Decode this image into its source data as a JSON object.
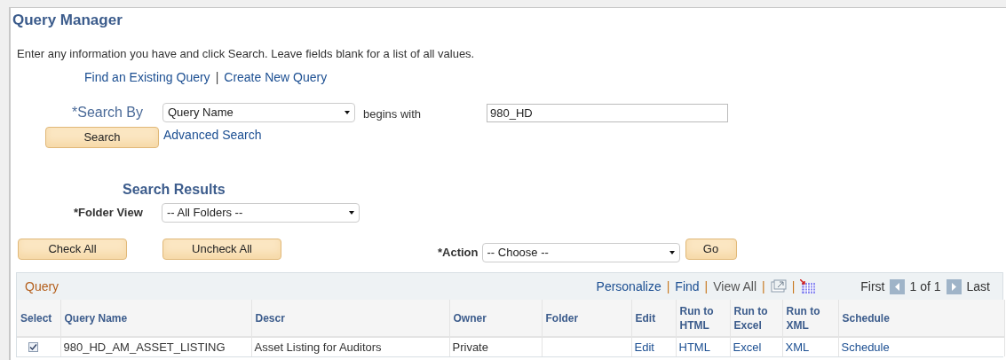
{
  "title": "Query Manager",
  "instructions": "Enter any information you have and click Search. Leave fields blank for a list of all values.",
  "nav_links": [
    {
      "kind": "link",
      "label": "Find an Existing Query"
    },
    {
      "kind": "separator",
      "label": "|"
    },
    {
      "kind": "link",
      "label": "Create New Query"
    }
  ],
  "search_by": {
    "label": "*Search By",
    "value": "Query Name",
    "operator": "begins with",
    "text": "980_HD"
  },
  "search_button": "Search",
  "advanced_search": "Advanced Search",
  "results_heading": "Search Results",
  "folder_view": {
    "label": "*Folder View",
    "value": "-- All Folders --"
  },
  "check_all": "Check All",
  "uncheck_all": "Uncheck All",
  "action": {
    "label": "*Action",
    "value": "-- Choose --"
  },
  "go_button": "Go",
  "grid": {
    "title": "Query",
    "toolbar": [
      {
        "label": "Personalize",
        "kind": "link"
      },
      {
        "label": "|",
        "kind": "separator"
      },
      {
        "label": "Find",
        "kind": "link"
      },
      {
        "label": "|",
        "kind": "separator"
      },
      {
        "label": "View All",
        "kind": "text"
      },
      {
        "label": "|",
        "kind": "separator"
      },
      {
        "kind": "new_window"
      },
      {
        "label": "|",
        "kind": "separator"
      },
      {
        "kind": "spreadsheet"
      }
    ],
    "pagination": {
      "first": "First",
      "count": "1 of 1",
      "last": "Last"
    },
    "columns": [
      "Select",
      "Query Name",
      "Descr",
      "Owner",
      "Folder",
      "Edit",
      "Run to HTML",
      "Run to Excel",
      "Run to XML",
      "Schedule"
    ],
    "rows": [
      {
        "cells": [
          {
            "kind": "checkbox",
            "checked": true
          },
          {
            "kind": "text",
            "text": "980_HD_AM_ASSET_LISTING"
          },
          {
            "kind": "text",
            "text": "Asset Listing for Auditors"
          },
          {
            "kind": "text",
            "text": "Private"
          },
          {
            "kind": "empty"
          },
          {
            "kind": "link",
            "text": "Edit"
          },
          {
            "kind": "link",
            "text": "HTML"
          },
          {
            "kind": "link",
            "text": "Excel"
          },
          {
            "kind": "link",
            "text": "XML"
          },
          {
            "kind": "link",
            "text": "Schedule"
          }
        ]
      }
    ]
  }
}
